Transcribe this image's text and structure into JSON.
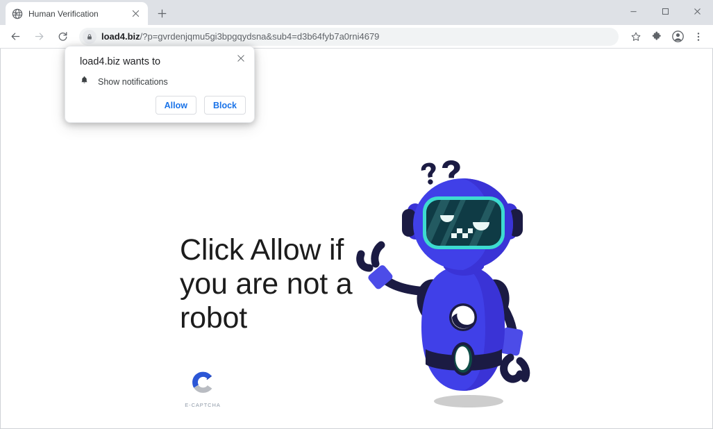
{
  "window": {
    "controls": [
      {
        "name": "minimize",
        "glyph": "minimize-icon"
      },
      {
        "name": "maximize",
        "glyph": "maximize-icon"
      },
      {
        "name": "close",
        "glyph": "close-icon"
      }
    ]
  },
  "tab": {
    "title": "Human Verification",
    "favicon": "globe-icon",
    "close_icon": "close-icon",
    "newtab_icon": "plus-icon"
  },
  "toolbar": {
    "back_icon": "arrow-left-icon",
    "forward_icon": "arrow-right-icon",
    "reload_icon": "reload-icon",
    "lock_icon": "lock-icon",
    "url_domain": "load4.biz",
    "url_path": "/?p=gvrdenjqmu5gi3bpgqydsna&sub4=d3b64fyb7a0rni4679",
    "url_full": "load4.biz/?p=gvrdenjqmu5gi3bpgqydsna&sub4=d3b64fyb7a0rni4679",
    "bookmark_icon": "star-icon",
    "extensions_icon": "puzzle-icon",
    "profile_icon": "account-avatar-icon",
    "menu_icon": "three-dot-menu-icon"
  },
  "permission_dialog": {
    "title": "load4.biz wants to",
    "request_icon": "bell-icon",
    "request_label": "Show notifications",
    "allow_label": "Allow",
    "block_label": "Block",
    "close_icon": "close-icon",
    "accent_color": "#1a73e8"
  },
  "page": {
    "headline": "Click Allow if you are not a robot",
    "captcha_brand": "E-CAPTCHA",
    "captcha_logo_icon": "c-logo-icon",
    "robot_illustration": "confused-robot-icon",
    "question_marks": "??",
    "colors": {
      "robot_blue": "#4040e8",
      "robot_blue_dark": "#3a33d6",
      "robot_navy": "#1b1b43",
      "screen_teal": "#0f3b45",
      "screen_border": "#3ddbd0",
      "shadow_grey": "#cdcdcd",
      "captcha_blue": "#2b56d6",
      "captcha_grey": "#9aa0a6"
    }
  }
}
